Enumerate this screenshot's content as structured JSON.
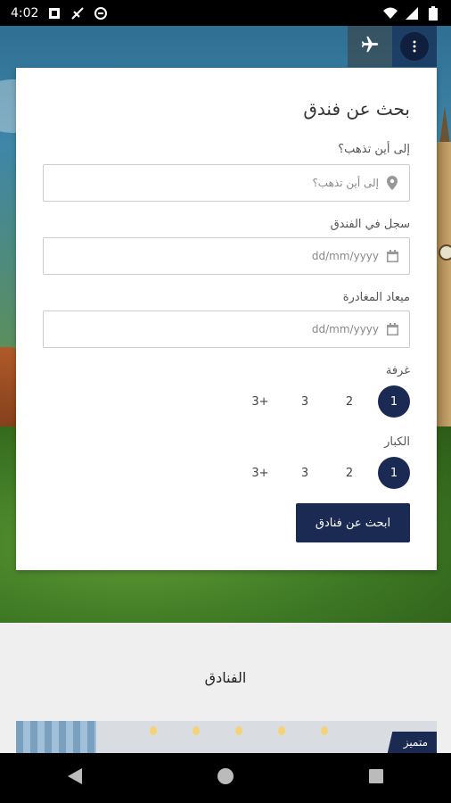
{
  "status_bar": {
    "time": "4:02"
  },
  "header_actions": {
    "plane_icon": "airplane-icon",
    "menu_icon": "menu-icon"
  },
  "search_card": {
    "title": "بحث عن فندق",
    "destination": {
      "label": "إلى أين تذهب؟",
      "placeholder": "إلى أين تذهب؟"
    },
    "check_in": {
      "label": "سجل في الفندق",
      "placeholder": "dd/mm/yyyy"
    },
    "check_out": {
      "label": "ميعاد المغادرة",
      "placeholder": "dd/mm/yyyy"
    },
    "rooms": {
      "label": "غرفة",
      "options": [
        "1",
        "2",
        "3",
        "3+"
      ],
      "selected": "1"
    },
    "adults": {
      "label": "الكبار",
      "options": [
        "1",
        "2",
        "3",
        "3+"
      ],
      "selected": "1"
    },
    "search_button": "ابحث عن فنادق"
  },
  "hotels_section": {
    "title": "الفنادق",
    "badge": "متميز"
  },
  "colors": {
    "primary": "#1a2a52",
    "background": "#efefef"
  }
}
